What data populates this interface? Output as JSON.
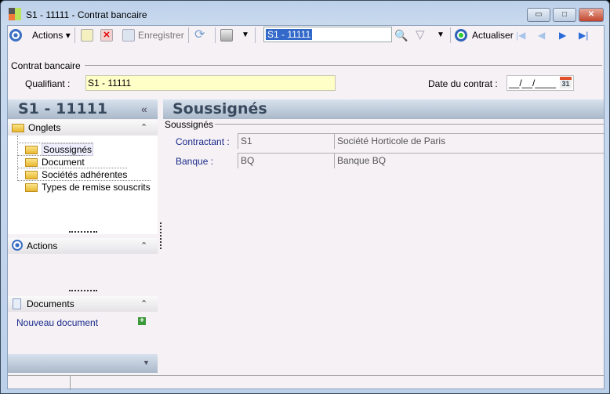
{
  "window": {
    "title": "S1 - 11111 -  Contrat bancaire",
    "minimize": "▭",
    "maximize": "□",
    "close": "✕"
  },
  "toolbar": {
    "actions_label": "Actions",
    "save_label": "Enregistrer",
    "search_value": "S1 - 11111",
    "refresh_label": "Actualiser"
  },
  "group": {
    "title": "Contrat bancaire",
    "qualifiant_label": "Qualifiant :",
    "qualifiant_value": "S1 - 11111",
    "date_label": "Date du contrat :",
    "date_value": "__/__/____",
    "calendar_day": "31"
  },
  "sidebar": {
    "title": "S1 - 11111",
    "collapse": "«",
    "onglets_title": "Onglets",
    "tabs": [
      "Soussignés",
      "Document",
      "Sociétés adhérentes",
      "Types de remise souscrits"
    ],
    "actions_title": "Actions",
    "documents_title": "Documents",
    "new_document": "Nouveau document"
  },
  "main": {
    "title": "Soussignés",
    "section": "Soussignés",
    "rows": [
      {
        "label": "Contractant :",
        "code": "S1",
        "name": "Société Horticole de Paris"
      },
      {
        "label": "Banque :",
        "code": "BQ",
        "name": "Banque BQ"
      }
    ]
  }
}
